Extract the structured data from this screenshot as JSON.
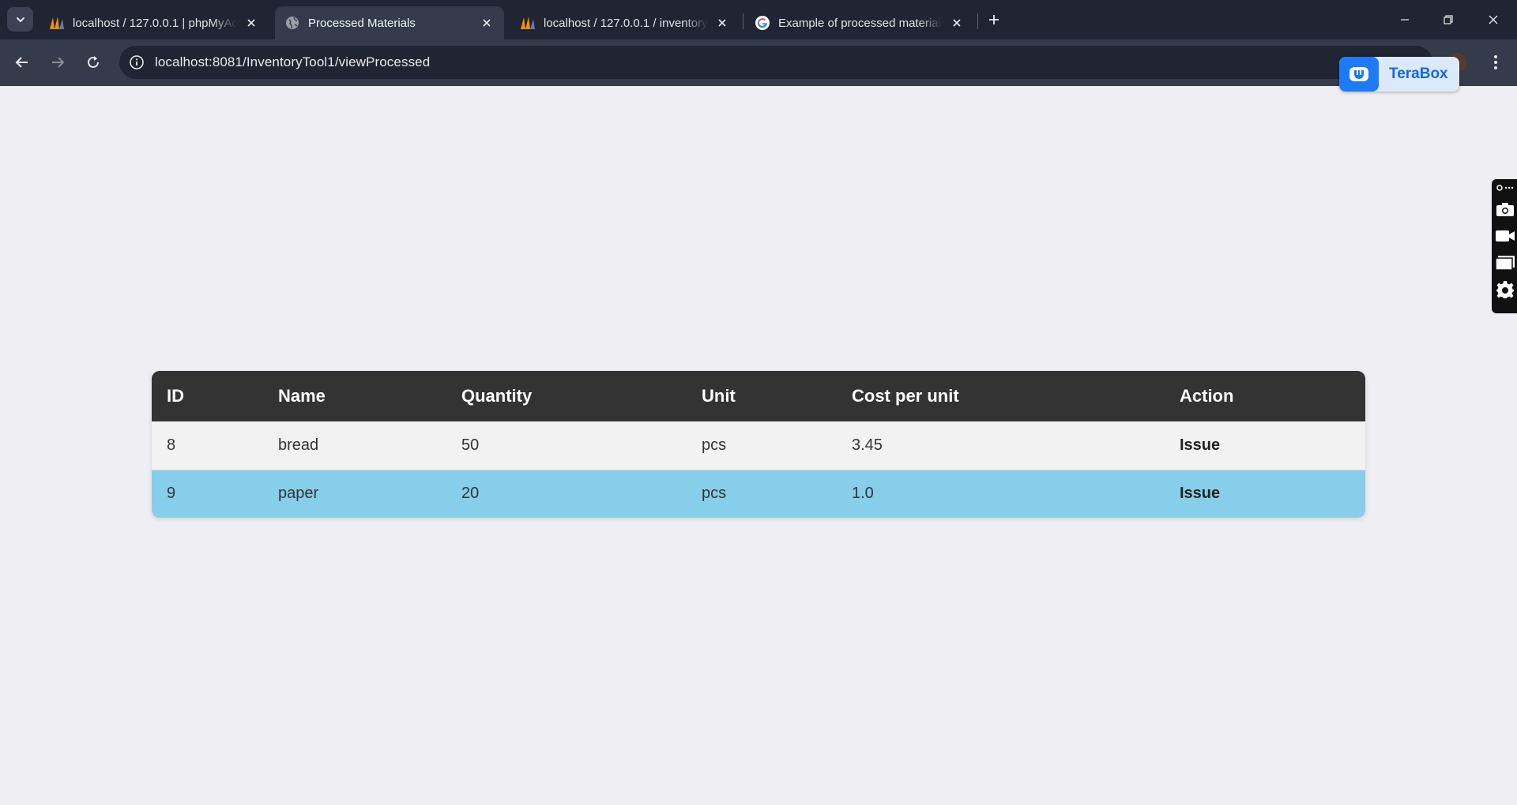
{
  "browser": {
    "tabs": [
      {
        "title": "localhost / 127.0.0.1 | phpMyAdmin",
        "favicon": "phpmyadmin-icon",
        "active": false
      },
      {
        "title": "Processed Materials",
        "favicon": "globe-icon",
        "active": true
      },
      {
        "title": "localhost / 127.0.0.1 / inventory",
        "favicon": "phpmyadmin-icon",
        "active": false
      },
      {
        "title": "Example of processed materials",
        "favicon": "google-icon",
        "active": false
      }
    ],
    "url": "localhost:8081/InventoryTool1/viewProcessed",
    "extension_badge": "TeraBox"
  },
  "table": {
    "headers": {
      "id": "ID",
      "name": "Name",
      "quantity": "Quantity",
      "unit": "Unit",
      "cost": "Cost per unit",
      "action": "Action"
    },
    "rows": [
      {
        "id": "8",
        "name": "bread",
        "quantity": "50",
        "unit": "pcs",
        "cost": "3.45",
        "action": "Issue"
      },
      {
        "id": "9",
        "name": "paper",
        "quantity": "20",
        "unit": "pcs",
        "cost": "1.0",
        "action": "Issue"
      }
    ]
  },
  "colors": {
    "header_bg": "#333333",
    "row_even_bg": "#f2f2f2",
    "row_highlight_bg": "#87ceeb",
    "page_bg": "#efeef2"
  }
}
